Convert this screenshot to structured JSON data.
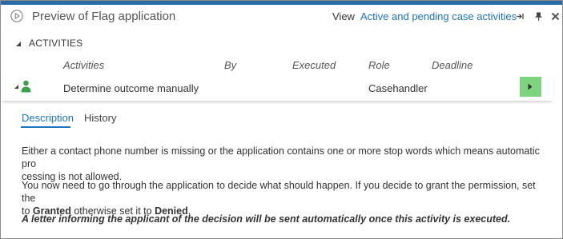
{
  "header": {
    "title": "Preview of Flag application",
    "view_label": "View",
    "view_link": "Active and pending case activities"
  },
  "section": {
    "title": "ACTIVITIES"
  },
  "columns": [
    "Activities",
    "By",
    "Executed",
    "Role",
    "Deadline"
  ],
  "row": {
    "activity": "Determine outcome manually",
    "role": "Casehandler"
  },
  "tabs": [
    "Description",
    "History"
  ],
  "description": {
    "p1_line1": "Either a contact phone number is missing or the application contains one or more stop words which means automatic pro",
    "p1_line2": "cessing is not allowed.",
    "p2_line1": "You now need to go through the application to decide what should happen. If you decide to grant the permission, set the",
    "p2_to": "to ",
    "p2_granted": "Granted",
    "p2_otherwise": " otherwise set it to ",
    "p2_denied": "Denied",
    "p2_end": ".",
    "p3": "A letter informing the applicant of the decision will be sent automatically once this activity is executed."
  },
  "colors": {
    "accent": "#1e73be",
    "topbar": "#2a6aa5",
    "go_button": "#7ed37e",
    "person_icon": "#3aa34a"
  }
}
